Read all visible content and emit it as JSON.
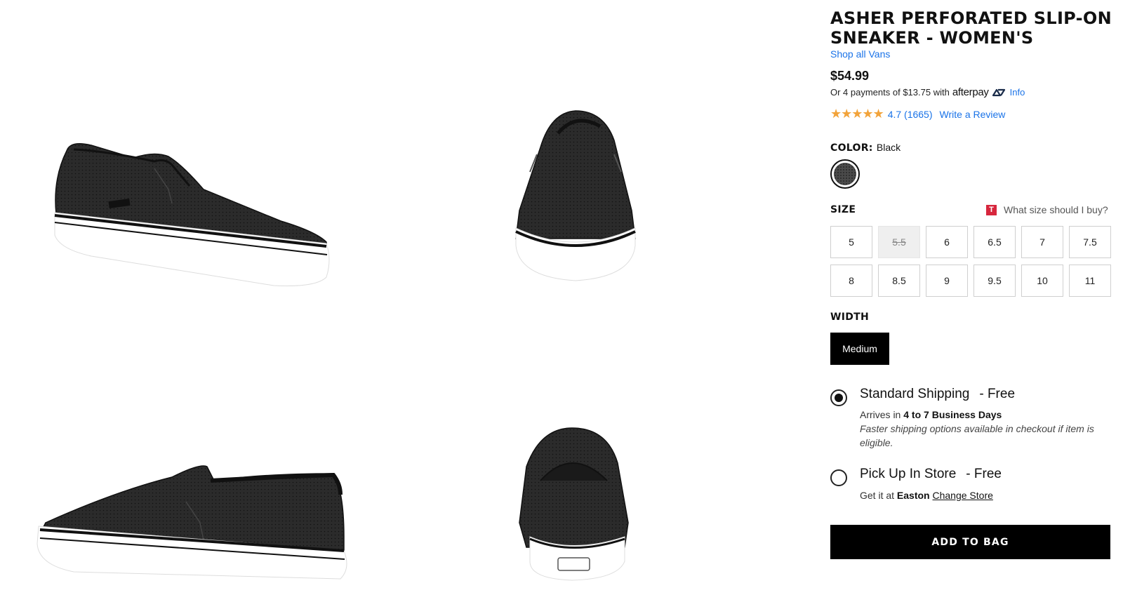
{
  "product": {
    "title": "ASHER PERFORATED SLIP-ON SNEAKER - WOMEN'S",
    "brand_link": "Shop all Vans",
    "price": "$54.99",
    "afterpay_prefix": "Or 4 payments of $13.75 with",
    "afterpay_logo": "afterpay",
    "afterpay_info": "Info",
    "stars": "★★★★★",
    "rating": "4.7 (1665)",
    "write_review": "Write a Review"
  },
  "color": {
    "label": "COLOR:",
    "selected": "Black",
    "swatch_color": "#4a4a4a"
  },
  "size": {
    "label": "SIZE",
    "guide_icon": "T",
    "guide_text": "What size should I buy?",
    "options": [
      "5",
      "5.5",
      "6",
      "6.5",
      "7",
      "7.5",
      "8",
      "8.5",
      "9",
      "9.5",
      "10",
      "11"
    ],
    "unavailable": [
      "5.5"
    ]
  },
  "width": {
    "label": "WIDTH",
    "selected": "Medium"
  },
  "shipping": {
    "standard": {
      "title": "Standard Shipping",
      "price": "- Free",
      "arrives_prefix": "Arrives in",
      "arrives_days": "4 to 7 Business Days",
      "note": "Faster shipping options available in checkout if item is eligible.",
      "selected": true
    },
    "pickup": {
      "title": "Pick Up In Store",
      "price": "- Free",
      "get_prefix": "Get it at",
      "store": "Easton",
      "change_store": "Change Store",
      "selected": false
    }
  },
  "cta": {
    "add_to_bag": "ADD TO BAG"
  },
  "gallery": {
    "views": [
      "side-right",
      "front",
      "side-left",
      "back"
    ],
    "shoe_color": "#2b2b2b",
    "sole_color": "#ffffff"
  }
}
